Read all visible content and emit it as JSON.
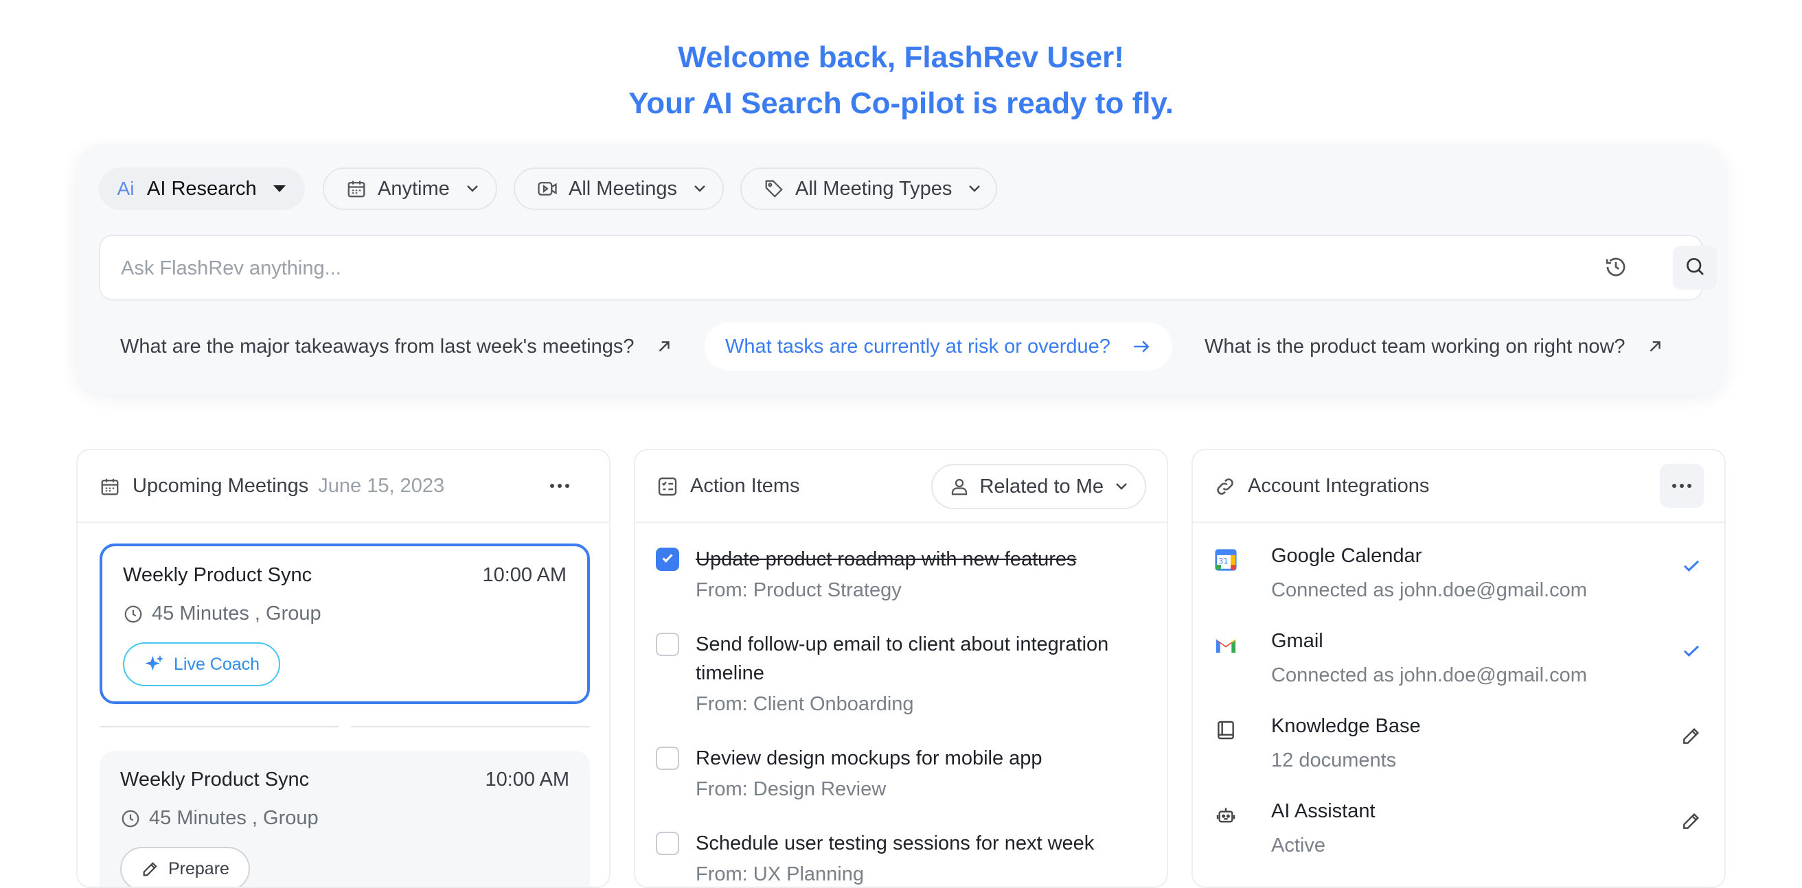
{
  "hero": {
    "line1": "Welcome back, FlashRev User!",
    "line2": "Your AI Search Co-pilot is ready to fly."
  },
  "filters": {
    "mode": {
      "label": "AI Research",
      "icon": "ai-icon"
    },
    "time": {
      "label": "Anytime",
      "icon": "calendar-icon"
    },
    "meetings": {
      "label": "All Meetings",
      "icon": "video-icon"
    },
    "types": {
      "label": "All Meeting Types",
      "icon": "tag-icon"
    }
  },
  "search": {
    "placeholder": "Ask FlashRev anything...",
    "value": ""
  },
  "suggestions": [
    {
      "text": "What are the major takeaways from last week's meetings?"
    },
    {
      "text": "What tasks are currently at risk or overdue?"
    },
    {
      "text": "What is the product team working on right now?"
    }
  ],
  "upcoming": {
    "title": "Upcoming Meetings",
    "date": "June 15, 2023",
    "meetings": [
      {
        "title": "Weekly Product Sync",
        "time": "10:00 AM",
        "details": "45 Minutes , Group",
        "action": "Live Coach"
      },
      {
        "title": "Weekly Product Sync",
        "time": "10:00 AM",
        "details": "45 Minutes , Group",
        "action": "Prepare"
      }
    ]
  },
  "actions": {
    "title": "Action Items",
    "filter": "Related to Me",
    "items": [
      {
        "text": "Update product roadmap with new features",
        "from": "From: Product Strategy",
        "done": true
      },
      {
        "text": "Send follow-up email to client about integration timeline",
        "from": "From: Client Onboarding",
        "done": false
      },
      {
        "text": "Review design mockups for mobile app",
        "from": "From: Design Review",
        "done": false
      },
      {
        "text": "Schedule user testing sessions for next week",
        "from": "From: UX Planning",
        "done": false
      }
    ]
  },
  "integrations": {
    "title": "Account Integrations",
    "items": [
      {
        "name": "Google Calendar",
        "detail": "Connected as john.doe@gmail.com",
        "icon": "google-calendar-icon",
        "status": "check-icon"
      },
      {
        "name": "Gmail",
        "detail": "Connected as john.doe@gmail.com",
        "icon": "gmail-icon",
        "status": "check-icon"
      },
      {
        "name": "Knowledge Base",
        "detail": "12 documents",
        "icon": "book-icon",
        "status": "edit-icon"
      },
      {
        "name": "AI Assistant",
        "detail": "Active",
        "icon": "robot-icon",
        "status": "edit-icon"
      }
    ]
  },
  "colors": {
    "accent": "#3b7cf0",
    "live": "#46c6f0",
    "muted": "#7a8088"
  }
}
